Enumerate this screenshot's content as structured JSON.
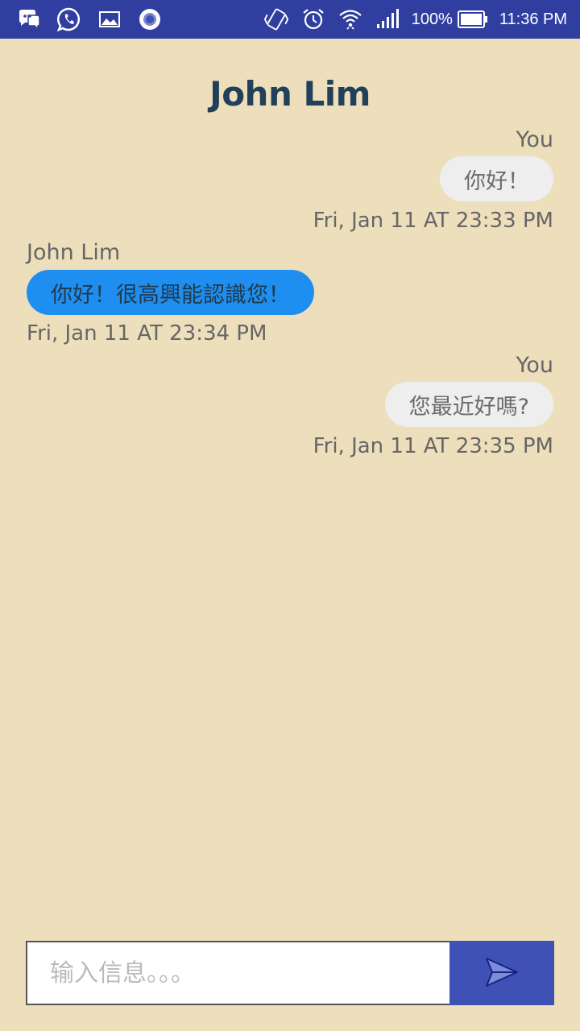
{
  "status_bar": {
    "battery_percent": "100%",
    "time": "11:36 PM",
    "left_icons": [
      "discord-icon",
      "whatsapp-icon",
      "gallery-icon",
      "record-icon"
    ],
    "right_icons": [
      "vibrate-icon",
      "alarm-icon",
      "wifi-icon",
      "signal-icon",
      "battery-icon"
    ]
  },
  "chat": {
    "title": "John Lim",
    "messages": [
      {
        "sender": "You",
        "text": "你好！",
        "timestamp": "Fri, Jan 11 AT 23:33 PM",
        "direction": "outgoing"
      },
      {
        "sender": "John Lim",
        "text": "你好！很高興能認識您！",
        "timestamp": "Fri, Jan 11 AT 23:34 PM",
        "direction": "incoming"
      },
      {
        "sender": "You",
        "text": "您最近好嗎?",
        "timestamp": "Fri, Jan 11 AT 23:35 PM",
        "direction": "outgoing"
      }
    ]
  },
  "composer": {
    "placeholder": "输入信息。。。",
    "value": ""
  },
  "colors": {
    "background": "#EDDFBC",
    "status_bar": "#303F9F",
    "title": "#22405A",
    "incoming_bubble": "#1E8FF1",
    "outgoing_bubble": "#EEEEEE",
    "send_button": "#3F51B5"
  }
}
